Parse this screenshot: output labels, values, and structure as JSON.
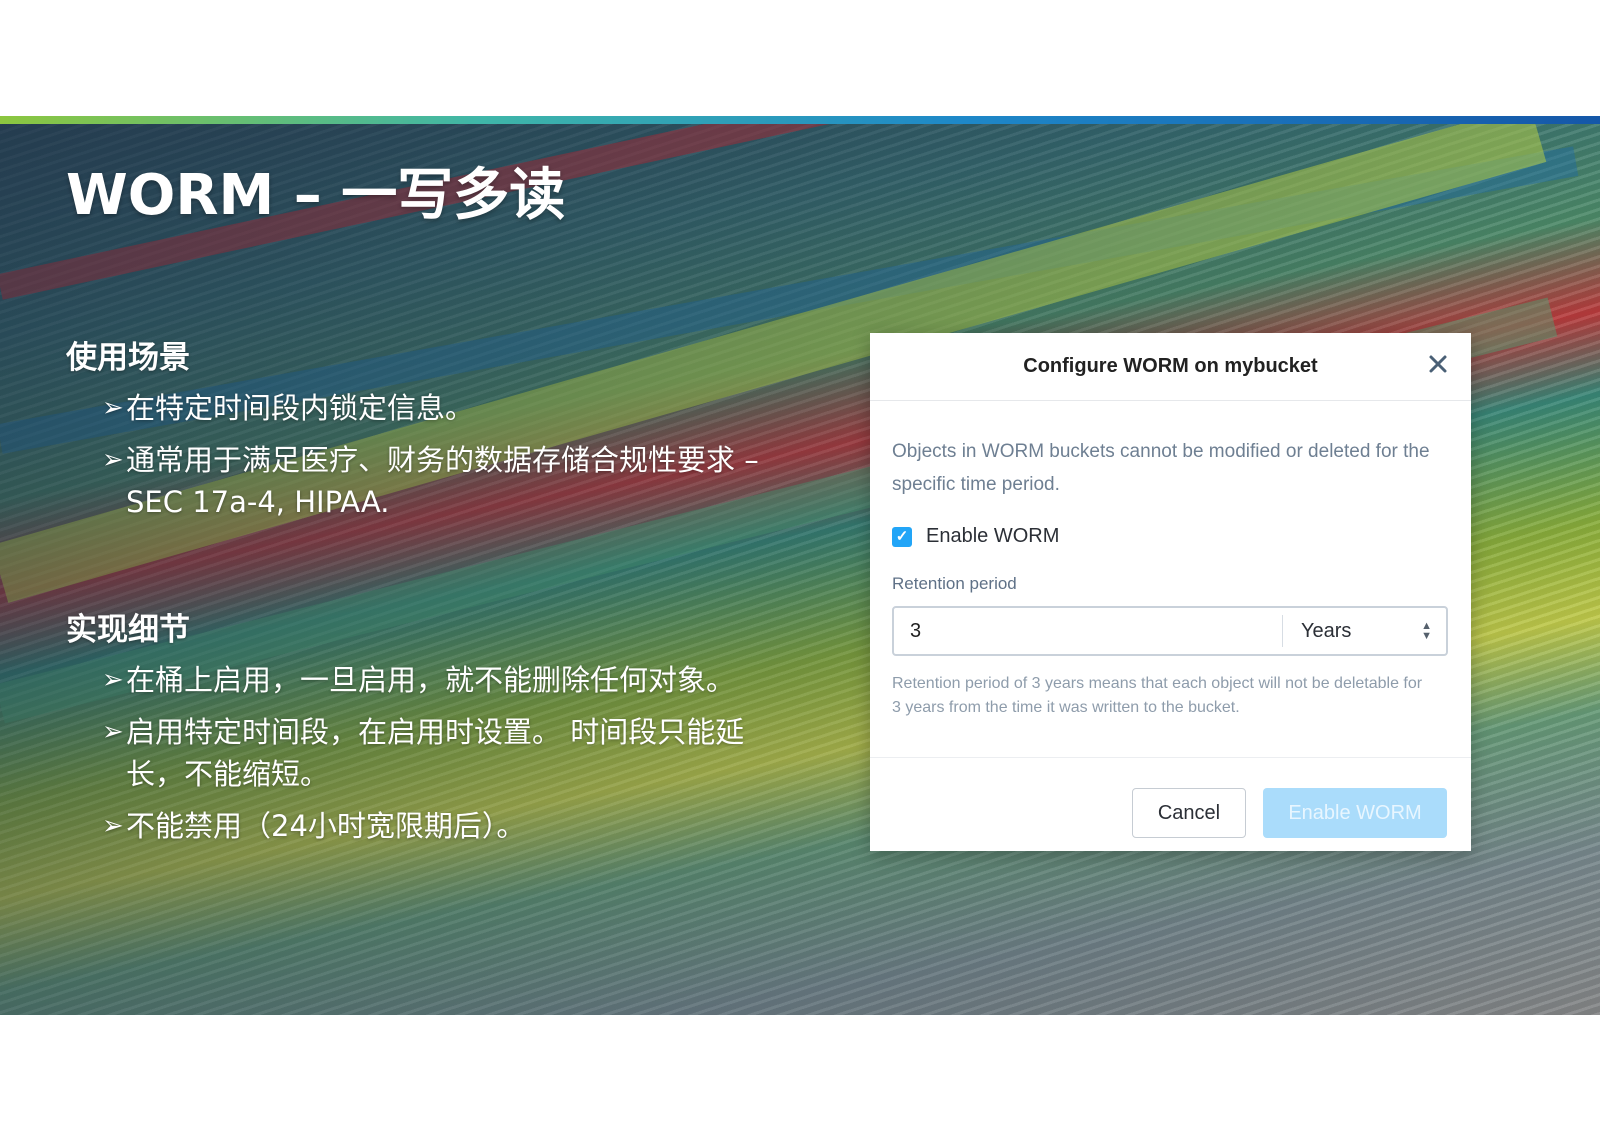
{
  "slide": {
    "title": "WORM – 一写多读",
    "sections": [
      {
        "heading": "使用场景",
        "bullets": [
          "在特定时间段内锁定信息。",
          "通常用于满足医疗、财务的数据存储合规性要求 – SEC 17a-4, HIPAA."
        ]
      },
      {
        "heading": "实现细节",
        "bullets": [
          "在桶上启用，一旦启用，就不能删除任何对象。",
          "启用特定时间段，在启用时设置。 时间段只能延长，不能缩短。",
          "不能禁用（24小时宽限期后）。"
        ]
      }
    ],
    "bullet_glyph": "➢",
    "colors": {
      "accent_gradient": [
        "#8cc63f",
        "#3fb6a8",
        "#1e88c8",
        "#1557a8"
      ],
      "title_text": "#ffffff"
    }
  },
  "dialog": {
    "title": "Configure WORM on mybucket",
    "close_icon": "close-icon",
    "description": "Objects in WORM buckets cannot be modified or deleted for the specific time period.",
    "enable_checkbox": {
      "label": "Enable WORM",
      "checked": true,
      "check_glyph": "✓"
    },
    "retention": {
      "label": "Retention period",
      "value": "3",
      "unit": "Years",
      "hint": "Retention period of 3 years means that each object will not be deletable for 3 years from the time it was written to the bucket."
    },
    "buttons": {
      "cancel": "Cancel",
      "enable": "Enable WORM"
    },
    "colors": {
      "checkbox": "#22a5f7",
      "primary_button_disabled": "#aadcfb"
    }
  }
}
